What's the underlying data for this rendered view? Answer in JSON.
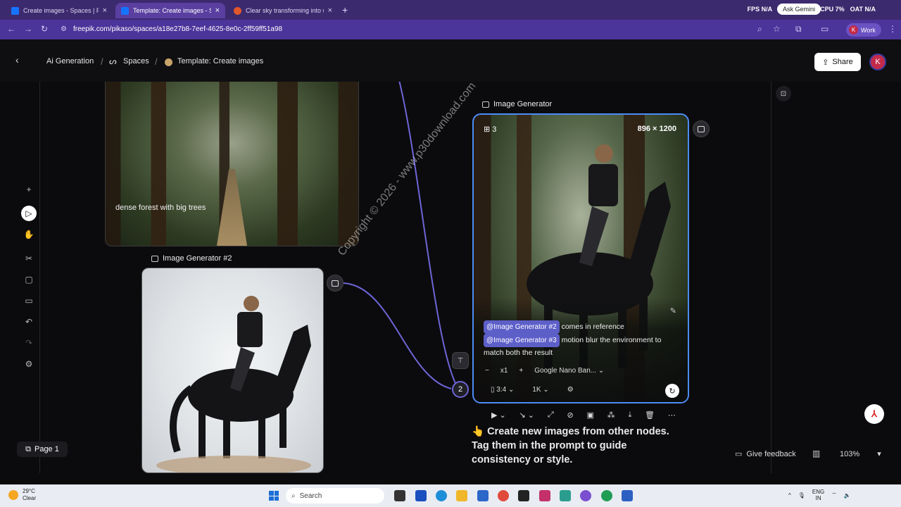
{
  "browser": {
    "tabs": [
      {
        "title": "Create images - Spaces | Freepik",
        "active": false
      },
      {
        "title": "Template: Create images - Spaces",
        "active": true
      },
      {
        "title": "Clear sky transforming into wat",
        "active": false
      }
    ],
    "url": "freepik.com/pikaso/spaces/a18e27b8-7eef-4625-8e0c-2ff59ff51a98",
    "ask_gemini": "Ask Gemini",
    "sysinfo": [
      "FPS N/A",
      "CPU 7%",
      "OAT N/A"
    ],
    "profile": {
      "initial": "K",
      "label": "Work"
    }
  },
  "header": {
    "crumbs": [
      "Ai Generation",
      "Spaces",
      "Template: Create images"
    ],
    "share_label": "Share",
    "user_initial": "K"
  },
  "nodes": {
    "forest_caption": "dense forest with big trees",
    "gen2_title": "Image Generator #2",
    "gen_title": "Image Generator",
    "gen_count": "3",
    "gen_size": "896 × 1200",
    "prompt_tag1": "@Image Generator #2",
    "prompt_text1": "comes in reference",
    "prompt_tag2": "@Image Generator #3",
    "prompt_text2": "motion blur the environment to match both the result",
    "qty": "x1",
    "model": "Google Nano Ban...",
    "ratio": "3:4",
    "resolution": "1K",
    "connector_count": "2"
  },
  "hint": "👆 Create new images from other nodes. Tag them in the prompt to guide consistency or style.",
  "footer": {
    "page_label": "Page 1",
    "feedback_label": "Give feedback",
    "zoom": "103%"
  },
  "watermark": "Copyright © 2026 - www.p30download.com",
  "taskbar": {
    "temp": "29°C",
    "condition": "Clear",
    "search": "Search",
    "lang": "ENG",
    "region": "IN"
  }
}
